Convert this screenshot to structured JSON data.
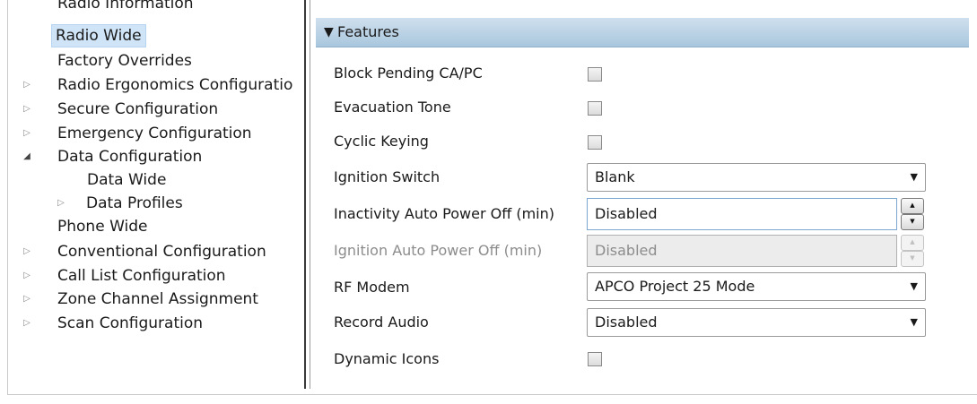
{
  "tree": {
    "cut_item": "Radio Information",
    "items": [
      {
        "label": "Radio Wide",
        "selected": true
      },
      {
        "label": "Factory Overrides"
      },
      {
        "label": "Radio Ergonomics Configuratio",
        "expander": "▷"
      },
      {
        "label": "Secure Configuration",
        "expander": "▷"
      },
      {
        "label": "Emergency Configuration",
        "expander": "▷"
      },
      {
        "label": "Data Configuration",
        "expander": "◢"
      },
      {
        "label": "Data Wide"
      },
      {
        "label": "Data Profiles",
        "expander": "▷"
      },
      {
        "label": "Phone Wide"
      },
      {
        "label": "Conventional Configuration",
        "expander": "▷"
      },
      {
        "label": "Call List Configuration",
        "expander": "▷"
      },
      {
        "label": "Zone Channel Assignment",
        "expander": "▷"
      },
      {
        "label": "Scan Configuration",
        "expander": "▷"
      }
    ]
  },
  "features": {
    "header_arrow": "▼",
    "title": "Features",
    "block_pending": {
      "label": "Block Pending CA/PC",
      "checked": false
    },
    "evacuation_tone": {
      "label": "Evacuation Tone",
      "checked": false
    },
    "cyclic_keying": {
      "label": "Cyclic Keying",
      "checked": false
    },
    "ignition_switch": {
      "label": "Ignition Switch",
      "value": "Blank"
    },
    "inactivity_auto_power_off": {
      "label": "Inactivity Auto Power Off (min)",
      "value": "Disabled"
    },
    "ignition_auto_power_off": {
      "label": "Ignition Auto Power Off (min)",
      "value": "Disabled",
      "enabled": false
    },
    "rf_modem": {
      "label": "RF Modem",
      "value": "APCO Project 25 Mode"
    },
    "record_audio": {
      "label": "Record Audio",
      "value": "Disabled"
    },
    "dynamic_icons": {
      "label": "Dynamic Icons",
      "checked": false
    }
  },
  "glyphs": {
    "caret": "▼",
    "spin_up": "▲",
    "spin_down": "▼"
  }
}
